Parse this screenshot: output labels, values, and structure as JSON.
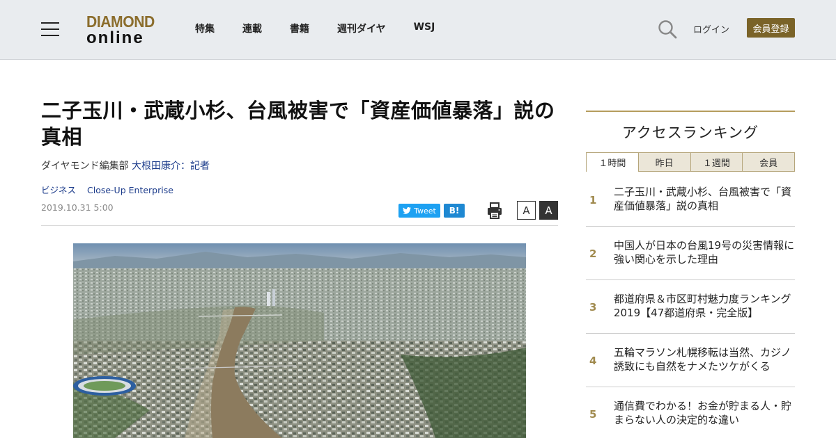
{
  "header": {
    "logo_top": "DIAMOND",
    "logo_bottom": "online",
    "nav": [
      "特集",
      "連載",
      "書籍",
      "週刊ダイヤ",
      "WSJ"
    ],
    "login_label": "ログイン",
    "register_label": "会員登録"
  },
  "article": {
    "title": "二子玉川・武蔵小杉、台風被害で「資産価値暴落」説の真相",
    "department": "ダイヤモンド編集部",
    "author": "大根田康介：記者",
    "categories": [
      "ビジネス",
      "Close-Up Enterprise"
    ],
    "date": "2019.10.31 5:00",
    "tweet_label": "Tweet",
    "hatena_label": "B!",
    "font_small_label": "A",
    "font_large_label": "A"
  },
  "ranking": {
    "title": "アクセスランキング",
    "tabs": [
      "１時間",
      "昨日",
      "１週間",
      "会員"
    ],
    "items": [
      {
        "rank": "1",
        "text": "二子玉川・武蔵小杉、台風被害で「資産価値暴落」説の真相"
      },
      {
        "rank": "2",
        "text": "中国人が日本の台風19号の災害情報に強い関心を示した理由"
      },
      {
        "rank": "3",
        "text": "都道府県＆市区町村魅力度ランキング2019【47都道府県・完全版】"
      },
      {
        "rank": "4",
        "text": "五輪マラソン札幌移転は当然、カジノ誘致にも自然をナメたツケがくる"
      },
      {
        "rank": "5",
        "text": "通信費でわかる！お金が貯まる人・貯まらない人の決定的な違い"
      }
    ]
  },
  "colors": {
    "header_bg": "#e9ecef",
    "brand_gold": "#8b6d2c",
    "register_bg": "#7a6328",
    "link_blue": "#1a3a8a",
    "tweet_blue": "#1da1f2",
    "hatena_blue": "#1e88d2",
    "rank_gold": "#a08a4e"
  },
  "icons": {
    "menu": "hamburger-menu-icon",
    "search": "search-icon",
    "print": "printer-icon",
    "twitter": "twitter-bird-icon"
  }
}
